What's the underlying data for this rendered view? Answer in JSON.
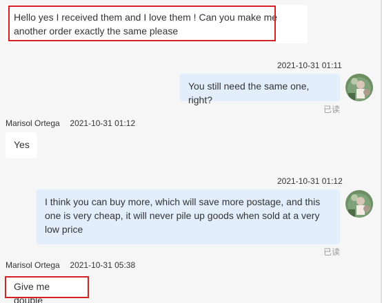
{
  "messages": [
    {
      "text": "Hello yes I received them and I love them ! Can you make me another order exactly the same please"
    },
    {
      "timestamp": "2021-10-31 01:11",
      "text": "You still need the same one, right?",
      "status": "已读"
    },
    {
      "sender": "Marisol Ortega",
      "timestamp": "2021-10-31 01:12",
      "text": "Yes"
    },
    {
      "timestamp": "2021-10-31 01:12",
      "text": "I think you can buy more, which will save more postage, and this one is very cheap, it will never pile up goods when sold at a very low price",
      "status": "已读"
    },
    {
      "sender": "Marisol Ortega",
      "timestamp": "2021-10-31 05:38",
      "text": "Give me double"
    }
  ],
  "colors": {
    "background": "#f6f6f6",
    "incoming_bubble": "#ffffff",
    "outgoing_bubble": "#e3eefc",
    "highlight_border": "#d71f26"
  },
  "icons": {
    "avatar": "user-avatar-photo"
  }
}
